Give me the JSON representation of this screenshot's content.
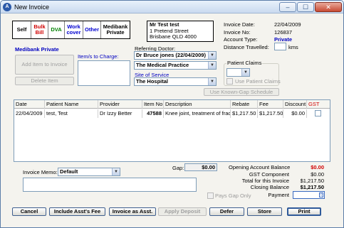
{
  "window": {
    "title": "New Invoice",
    "icon": "app-logo-icon"
  },
  "tabs": [
    {
      "label": "Self"
    },
    {
      "label": "Bulk Bill"
    },
    {
      "label": "DVA"
    },
    {
      "label": "Work cover"
    },
    {
      "label": "Other"
    },
    {
      "label": "Medibank Private"
    }
  ],
  "patient_block": {
    "name": "Mr Test test",
    "address1": "1 Pretend Street",
    "address2": "Brisbane QLD 4000"
  },
  "invoice_info": {
    "date_label": "Invoice Date:",
    "date_value": "22/04/2009",
    "no_label": "Invoice No:",
    "no_value": "126837",
    "type_label": "Account Type:",
    "type_value": "Private",
    "distance_label": "Distance Travelled:",
    "distance_value": "",
    "distance_unit": "kms"
  },
  "left_panel": {
    "fund_name": "Medibank Private",
    "items_label": "Item/s to Charge:",
    "add_item_button": "Add Item to Invoice",
    "delete_item_button": "Delete Item"
  },
  "referring": {
    "label": "Referring Doctor:",
    "doctor": "Dr Bruce jones (22/04/2009)",
    "practice": "The Medical Practice",
    "site_label": "Site of Service",
    "site": "The Hospital"
  },
  "patient_claims": {
    "label": "Patient Claims",
    "selected": "",
    "checkbox_label": "Use Patient Claims",
    "known_gap_button": "Use Known-Gap Schedule"
  },
  "grid": {
    "columns": [
      "Date",
      "Patient Name",
      "Provider",
      "Item No",
      "Description",
      "Rebate",
      "Fee",
      "Discount",
      "GST"
    ],
    "rows": [
      {
        "date": "22/04/2009",
        "patient": "test, Test",
        "provider": "Dr Izzy Better",
        "item_no": "47588",
        "description": "Knee joint, treatment of fract",
        "rebate": "$1,217.50",
        "fee": "$1,217.50",
        "discount": "$0.00"
      }
    ]
  },
  "memo": {
    "label": "Invoice Memo:",
    "selected": "Default"
  },
  "gap": {
    "label": "Gap:",
    "value": "$0.00"
  },
  "pays_gap_label": "Pays Gap Only",
  "summary": {
    "opening_label": "Opening Account Balance",
    "opening_value": "$0.00",
    "gst_label": "GST Component",
    "gst_value": "$0.00",
    "total_label": "Total for this Invoice",
    "total_value": "$1,217.50",
    "closing_label": "Closing Balance",
    "closing_value": "$1,217.50",
    "payment_label": "Payment"
  },
  "buttons": {
    "cancel": "Cancel",
    "include_asst": "Include Asst's Fee",
    "invoice_asst": "Invoice as Asst.",
    "apply_deposit": "Apply Deposit",
    "defer": "Defer",
    "store": "Store",
    "print": "Print"
  },
  "colors": {
    "accent_blue": "#0000c0",
    "alert_red": "#d00000",
    "bulk_red": "#d00000",
    "dva_green": "#008000"
  }
}
